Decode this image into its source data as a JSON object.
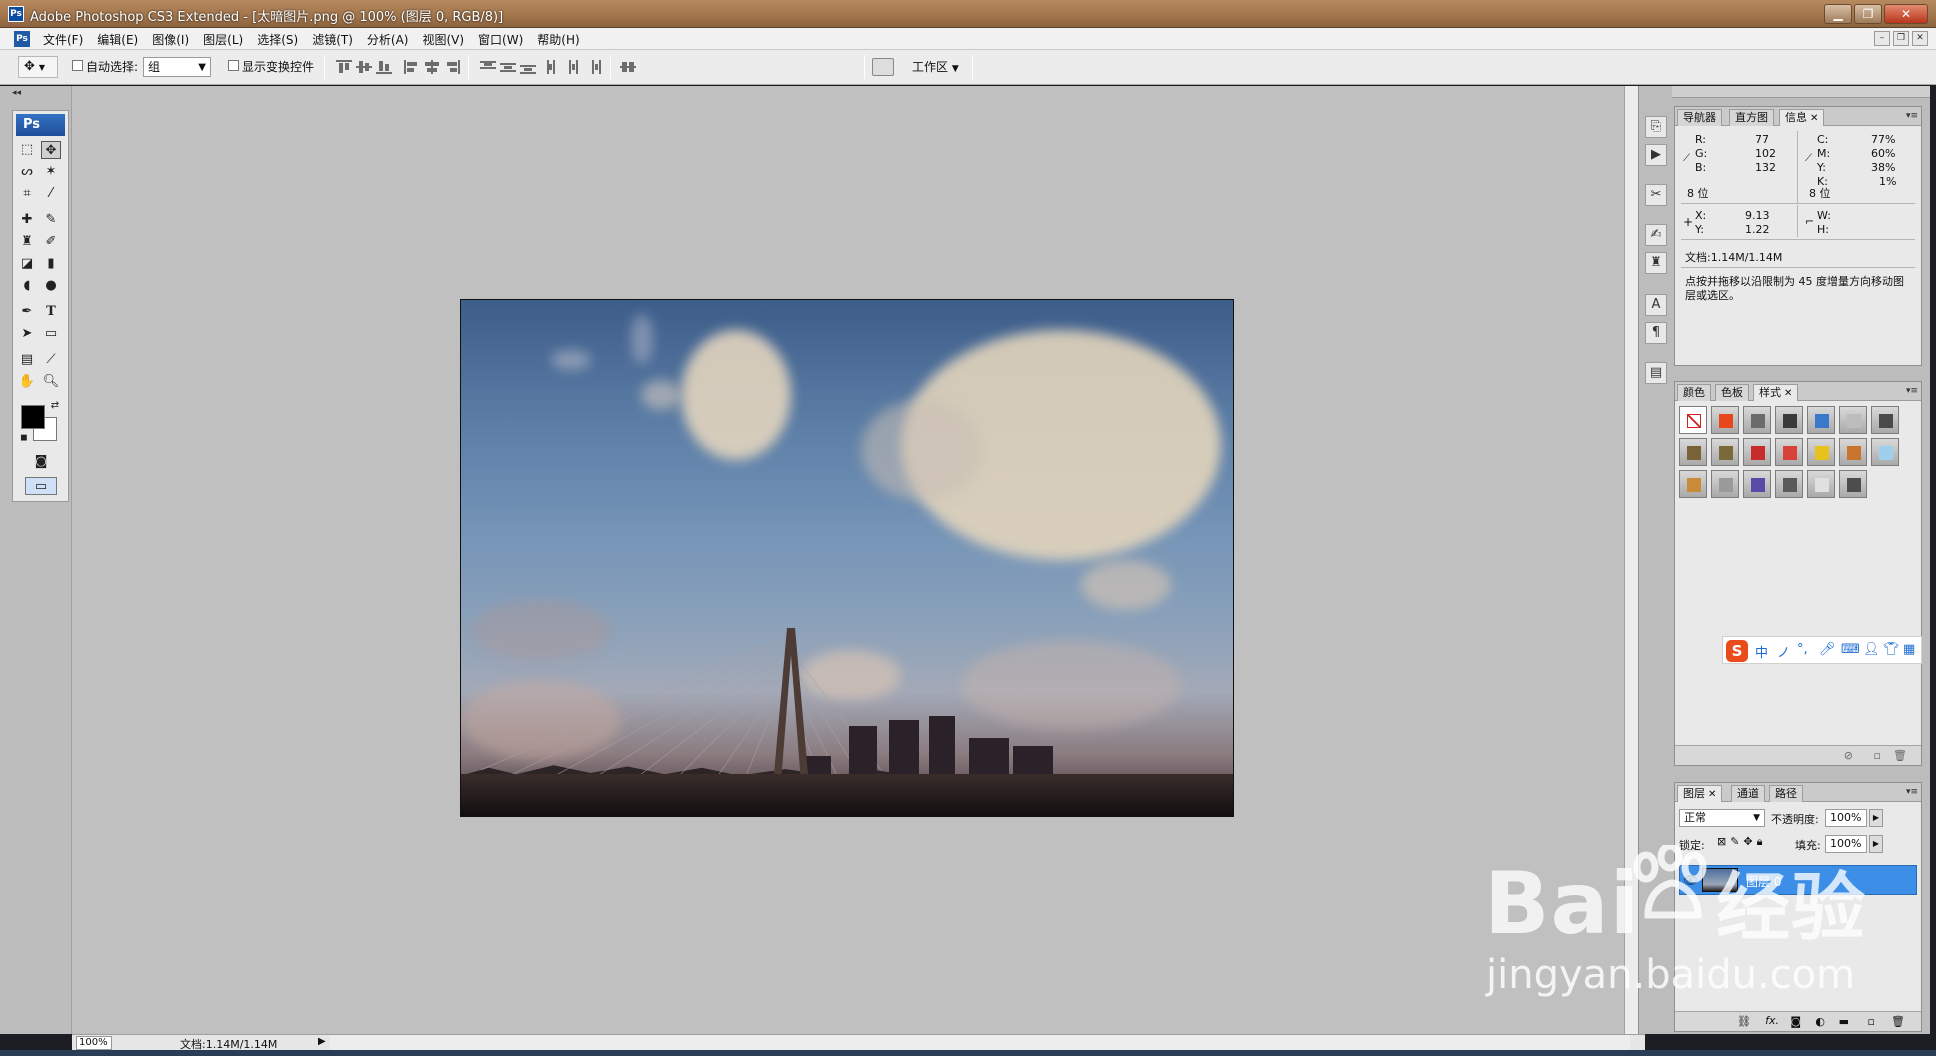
{
  "window": {
    "title": "Adobe Photoshop CS3 Extended - [太暗图片.png @ 100% (图层 0, RGB/8)]",
    "app_icon": "Ps"
  },
  "menu": {
    "items": [
      "文件(F)",
      "编辑(E)",
      "图像(I)",
      "图层(L)",
      "选择(S)",
      "滤镜(T)",
      "分析(A)",
      "视图(V)",
      "窗口(W)",
      "帮助(H)"
    ]
  },
  "options_bar": {
    "auto_select_label": "自动选择:",
    "auto_select_value": "组",
    "show_transform_label": "显示变换控件",
    "workspace_label": "工作区"
  },
  "toolbox": {
    "badge": "Ps",
    "type_tool": "T"
  },
  "status_bar": {
    "zoom": "100%",
    "doc_size": "文档:1.14M/1.14M"
  },
  "info_panel": {
    "tabs": [
      "导航器",
      "直方图",
      "信息"
    ],
    "active_tab": "信息",
    "rgb": {
      "r_label": "R:",
      "r": "77",
      "g_label": "G:",
      "g": "102",
      "b_label": "B:",
      "b": "132"
    },
    "cmyk": {
      "c_label": "C:",
      "c": "77%",
      "m_label": "M:",
      "m": "60%",
      "y_label": "Y:",
      "y": "38%",
      "k_label": "K:",
      "k": "1%"
    },
    "bit_left": "8 位",
    "bit_right": "8 位",
    "xy": {
      "x_label": "X:",
      "x": "9.13",
      "y_label": "Y:",
      "y": "1.22"
    },
    "wh": {
      "w_label": "W:",
      "h_label": "H:"
    },
    "doc_size": "文档:1.14M/1.14M",
    "hint": "点按并拖移以沿限制为 45 度增量方向移动图层或选区。"
  },
  "styles_panel": {
    "tabs": [
      "颜色",
      "色板",
      "样式"
    ],
    "active_tab": "样式",
    "swatch_colors": [
      "#ffffff",
      "#e8471b",
      "#6b6b6b",
      "#3a3a3a",
      "#3a78c9",
      "#bdbdbd",
      "#4a4a4a",
      "#7a6238",
      "#7a6a3a",
      "#c82b2b",
      "#d9423a",
      "#e7c11c",
      "#c9742c",
      "#9ed0ee",
      "#c98a3a",
      "#9a9a9a",
      "#5a4aa8",
      "#5a5a5a",
      "#e0e0e0",
      "#4d4d4d"
    ]
  },
  "ime_bar": {
    "logo": "S",
    "items": [
      "中",
      "ノ",
      "°,",
      "🎤",
      "⌨",
      "👤",
      "👕",
      "▦"
    ]
  },
  "layers_panel": {
    "tabs": [
      "图层",
      "通道",
      "路径"
    ],
    "active_tab": "图层",
    "blend_mode": "正常",
    "opacity_label": "不透明度:",
    "opacity": "100%",
    "lock_label": "锁定:",
    "fill_label": "填充:",
    "fill": "100%",
    "layers": [
      {
        "name": "图层 0",
        "visible": true,
        "selected": true
      }
    ],
    "footer_icons": [
      "link-icon",
      "fx-icon",
      "mask-icon",
      "adjustment-icon",
      "group-icon",
      "new-layer-icon",
      "trash-icon"
    ]
  },
  "watermark": {
    "brand": "Bai",
    "brand_tail": "经验",
    "url": "jingyan.baidu.com"
  }
}
